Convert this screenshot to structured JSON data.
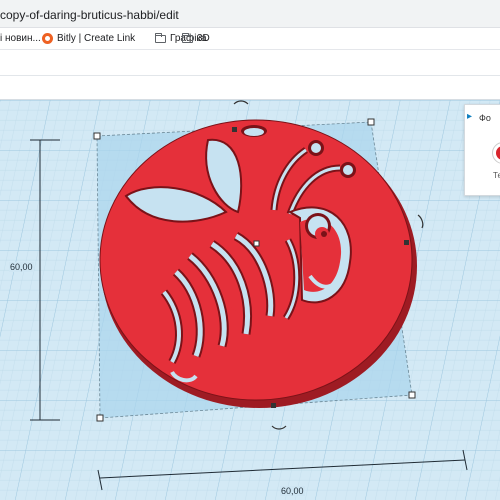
{
  "browser": {
    "url": "copy-of-daring-bruticus-habbi/edit"
  },
  "bookmarks": [
    {
      "label": "і новин..."
    },
    {
      "label": "Bitly | Create Link",
      "icon": "bitly-icon"
    },
    {
      "label": "Графіка",
      "icon": "folder-icon"
    },
    {
      "label": "3D",
      "icon": "folder-icon"
    }
  ],
  "panel": {
    "title": "Фо",
    "color_label": "Те",
    "color": "#d9252d"
  },
  "dimensions": {
    "height": "60,00",
    "width": "60,00"
  },
  "model": {
    "fill": "#e5303a",
    "shadow": "#9e1b23",
    "bbox_color": "#a9d4ec"
  }
}
